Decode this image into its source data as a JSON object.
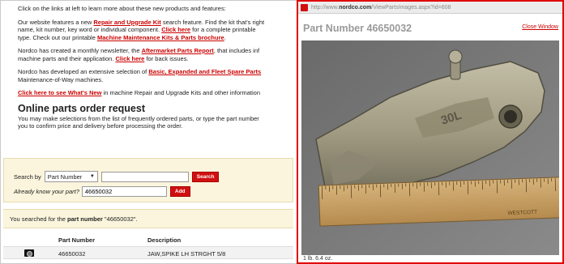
{
  "main": {
    "intro": "Click on the links at left to learn more about these new products and features:",
    "p1": {
      "a": "Our website features a new ",
      "link1": "Repair and Upgrade Kit",
      "b": " search feature.  Find the kit that's right",
      "line2a": "name, kit number, key word or individual component.  ",
      "link2": "Click here",
      "line2b": " for a complete printable",
      "line3a": "type.  Check out our printable ",
      "link3": "Machine Maintenance Kits & Parts brochure",
      "line3b": "."
    },
    "p2": {
      "a": "Nordco has created a monthly newsletter, the ",
      "link1": "Aftermarket Parts Report",
      "b": ", that includes inf",
      "line2a": "machine parts and their application.  ",
      "link2": "Click here",
      "line2b": " for back issues."
    },
    "p3": {
      "a": "Nordco has developed an extensive selection of ",
      "link1": "Basic, Expanded and Fleet Spare Parts",
      "line2": "Maintenance-of-Way machines."
    },
    "p4": {
      "link1": "Click here to see What's New",
      "b": " in machine Repair and Upgrade Kits and other information"
    },
    "order_title": "Online parts order request",
    "order_line1": "You may make selections from the list of frequently ordered parts, or type the part number",
    "order_line2": "you to confirm price and delivery before processing the order."
  },
  "search": {
    "search_by_label": "Search by",
    "search_by_value": "Part Number",
    "search_input_value": "",
    "search_button": "Search",
    "already_know_label": "Already know your part?",
    "part_input_value": "46650032",
    "add_button": "Add"
  },
  "result": {
    "prefix": "You searched for the ",
    "bold": "part number",
    "suffix": " \"46650032\"."
  },
  "table": {
    "headers": [
      "Part Number",
      "Description"
    ],
    "rows": [
      {
        "part_number": "46650032",
        "description": "JAW,SPIKE LH STRGHT 5/8"
      }
    ]
  },
  "popup": {
    "url_prefix": "http://www.",
    "url_domain": "nordco.com",
    "url_suffix": "/ViewPartsImages.aspx?id=608",
    "title": "Part Number 46650032",
    "close_link": "Close Window",
    "part_stamp": "30L",
    "ruler_text": "WESTCOTT",
    "weight": "1 lb. 6.4 oz."
  },
  "icons": {
    "camera": "camera-icon",
    "favicon": "nordco-favicon-icon",
    "caret": "chevron-down-icon"
  },
  "colors": {
    "link_red": "#cc0000",
    "button_red": "#d01010",
    "popup_border": "#e00000",
    "search_panel_bg": "#fbf5dd"
  }
}
